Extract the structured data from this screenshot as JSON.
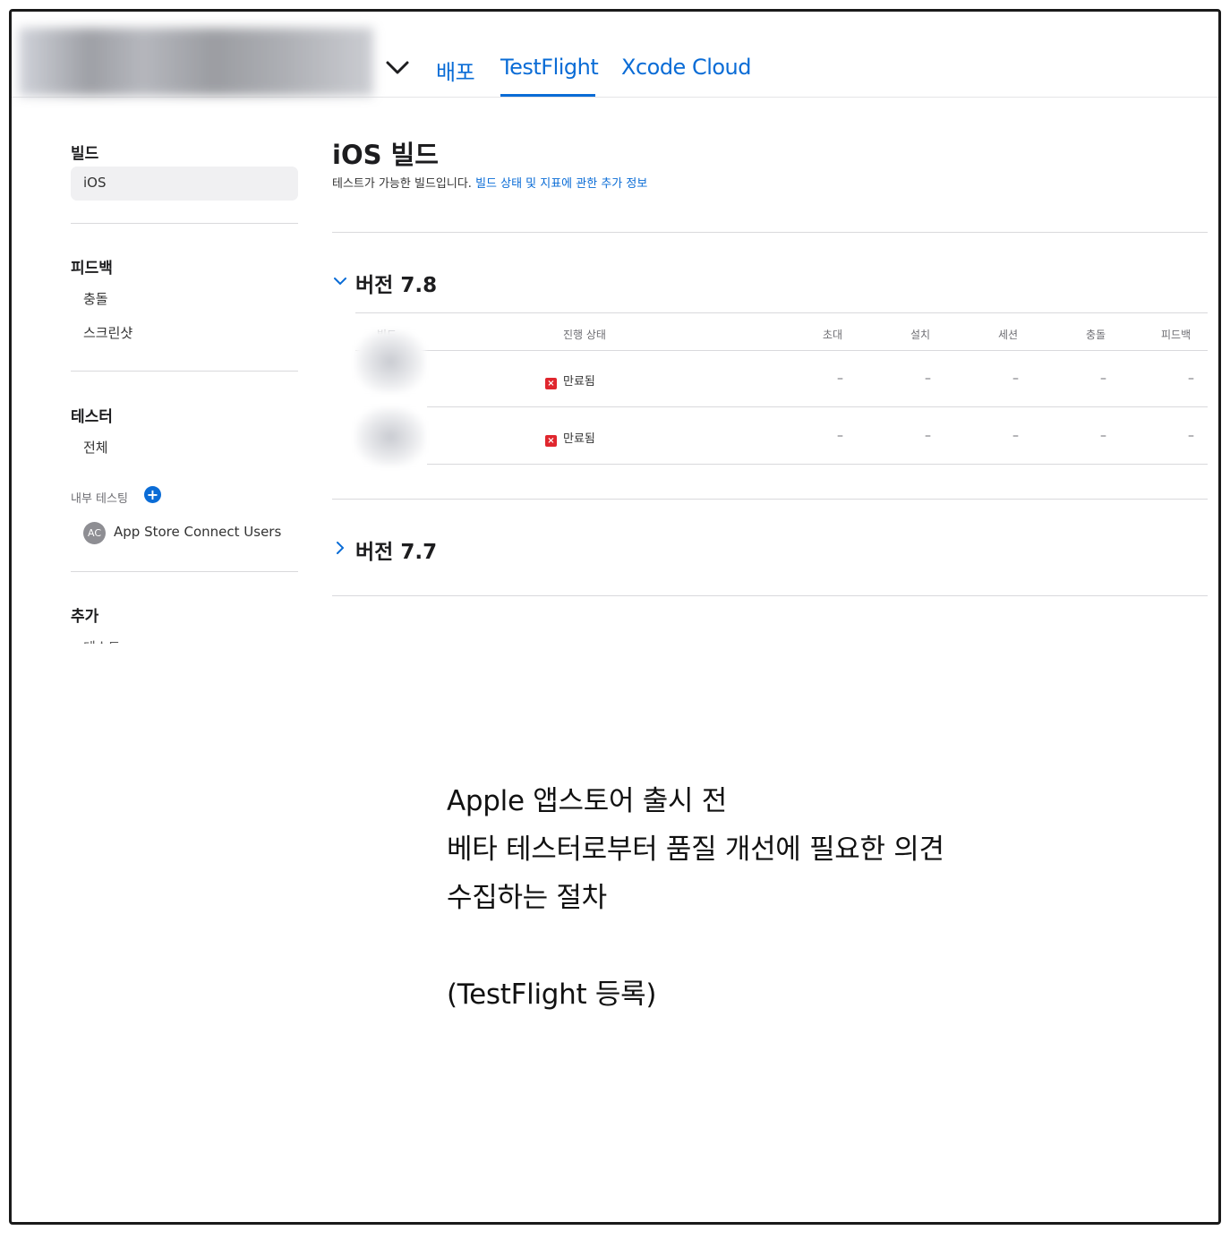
{
  "header": {
    "tabs": [
      {
        "label": "배포"
      },
      {
        "label": "TestFlight"
      },
      {
        "label": "Xcode Cloud"
      }
    ]
  },
  "sidebar": {
    "build_heading": "빌드",
    "build_ios": "iOS",
    "feedback_heading": "피드백",
    "feedback_crash": "충돌",
    "feedback_screenshot": "스크린샷",
    "testers_heading": "테스터",
    "testers_all": "전체",
    "internal_testing": "내부 테스팅",
    "group_avatar": "AC",
    "group_name": "App Store Connect Users",
    "more_heading": "추가",
    "more_cut": "테스트"
  },
  "main": {
    "title": "iOS 빌드",
    "subtitle": "테스트가 가능한 빌드입니다.",
    "subtitle_link": "빌드 상태 및 지표에 관한 추가 정보",
    "versions": [
      {
        "label": "버전 7.8"
      },
      {
        "label": "버전 7.7"
      }
    ],
    "table": {
      "headers": [
        "빌드",
        "진행 상태",
        "초대",
        "설치",
        "세션",
        "충돌",
        "피드백"
      ],
      "rows": [
        {
          "status": "만료됨",
          "invite": "–",
          "install": "–",
          "session": "–",
          "crash": "–",
          "feedback": "–"
        },
        {
          "status": "만료됨",
          "invite": "–",
          "install": "–",
          "session": "–",
          "crash": "–",
          "feedback": "–"
        }
      ]
    }
  },
  "caption": {
    "line1": "Apple 앱스토어 출시 전",
    "line2": "베타 테스터로부터 품질 개선에 필요한 의견",
    "line3": "수집하는 절차",
    "line4": "(TestFlight 등록)"
  },
  "colors": {
    "accent": "#0a6cd6",
    "expired": "#e0262e"
  }
}
